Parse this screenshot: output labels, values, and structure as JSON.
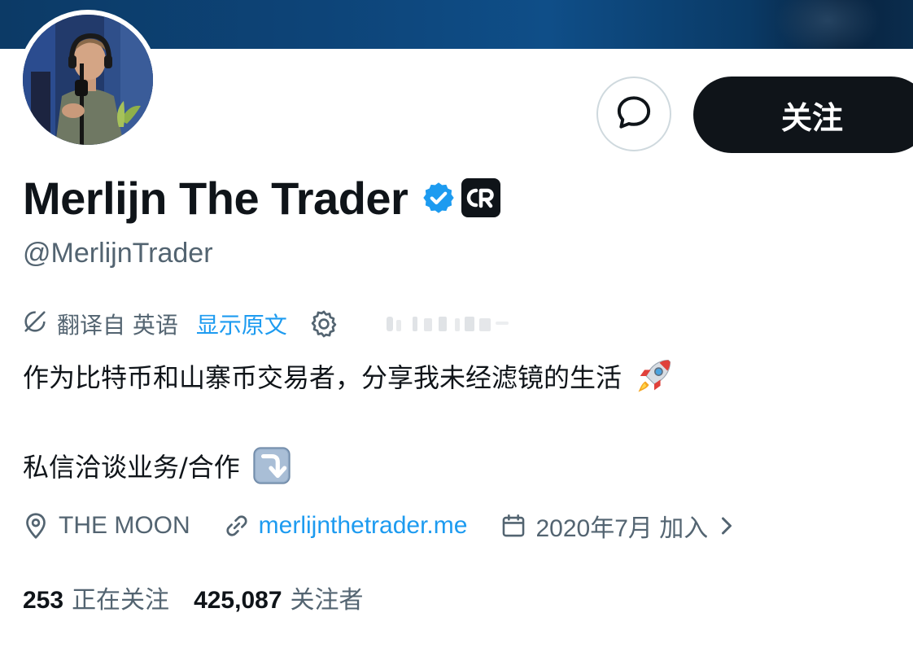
{
  "profile": {
    "display_name": "Merlijn The Trader",
    "handle": "@MerlijnTrader",
    "affiliate_badge_text": "CR",
    "verified_color": "#1d9bf0"
  },
  "actions": {
    "follow_label": "关注",
    "message_icon": "chat-bubble-icon"
  },
  "translation": {
    "label": "翻译自 英语",
    "show_original": "显示原文"
  },
  "bio": {
    "line1": "作为比特币和山寨币交易者，分享我未经滤镜的生活",
    "line1_emoji": "rocket",
    "line2": "私信洽谈业务/合作",
    "line2_emoji": "arrow-down-right-box"
  },
  "meta": {
    "location": "THE MOON",
    "website": "merlijnthetrader.me",
    "joined": "2020年7月 加入"
  },
  "stats": {
    "following_count": "253",
    "following_label": "正在关注",
    "followers_count": "425,087",
    "followers_label": "关注者"
  },
  "colors": {
    "accent": "#1d9bf0",
    "text_primary": "#0f1419",
    "text_secondary": "#536471",
    "banner": "#0d4478"
  }
}
